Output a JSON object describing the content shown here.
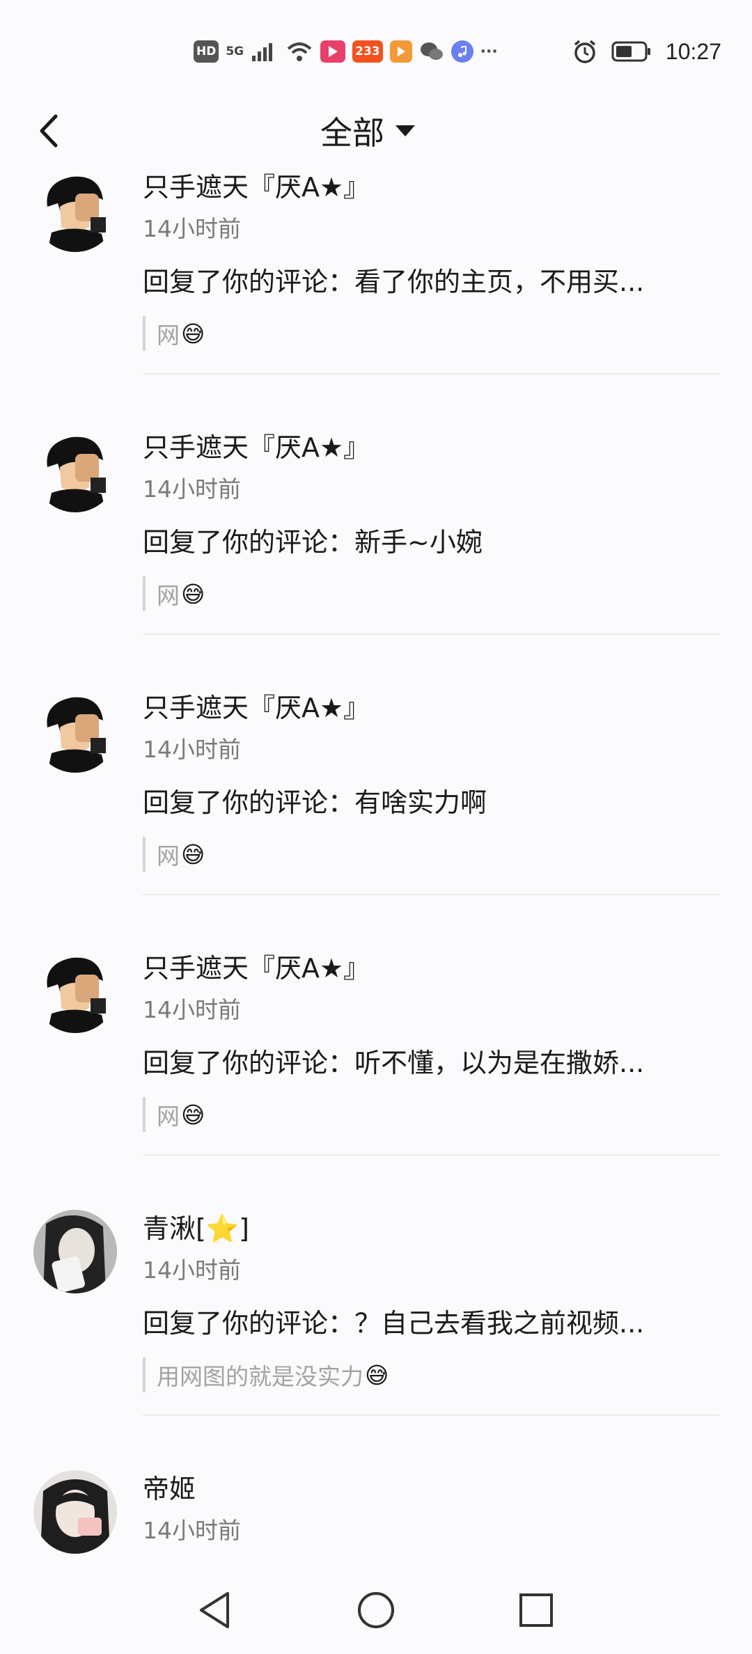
{
  "status_bar": {
    "hd_label": "HD",
    "network_label": "5G",
    "app_badge_233": "233",
    "more_label": "···",
    "time": "10:27"
  },
  "header": {
    "title": "全部"
  },
  "items": [
    {
      "user": "只手遮天『厌A★』",
      "time": "14小时前",
      "comment": "回复了你的评论：看了你的主页，不用买...",
      "quote": "网",
      "quote_emoji": "😅",
      "avatar": "anime-boy-avatar"
    },
    {
      "user": "只手遮天『厌A★』",
      "time": "14小时前",
      "comment": "回复了你的评论：新手~小婉",
      "quote": "网",
      "quote_emoji": "😅",
      "avatar": "anime-boy-avatar"
    },
    {
      "user": "只手遮天『厌A★』",
      "time": "14小时前",
      "comment": "回复了你的评论：有啥实力啊",
      "quote": "网",
      "quote_emoji": "😅",
      "avatar": "anime-boy-avatar"
    },
    {
      "user": "只手遮天『厌A★』",
      "time": "14小时前",
      "comment": "回复了你的评论：听不懂，以为是在撒娇...",
      "quote": "网",
      "quote_emoji": "😅",
      "avatar": "anime-boy-avatar"
    },
    {
      "user": "青湫[⭐]",
      "time": "14小时前",
      "comment": "回复了你的评论：？自己去看我之前视频...",
      "quote": "用网图的就是没实力",
      "quote_emoji": "😅",
      "avatar": "girl-photo-avatar"
    },
    {
      "user": "帝姬",
      "time": "14小时前",
      "comment": "",
      "quote": "",
      "quote_emoji": "",
      "avatar": "girl-photo-avatar-2"
    }
  ],
  "colors": {
    "background": "#fbfafc",
    "text_primary": "#1a1a1a",
    "text_secondary": "#7a7a7a",
    "quote_text": "#a3a3a3",
    "divider": "#ececec"
  },
  "icons": [
    "back-icon",
    "caret-down-icon",
    "wifi-icon",
    "signal-icon",
    "alarm-icon",
    "battery-icon",
    "nav-back-icon",
    "nav-home-icon",
    "nav-recents-icon"
  ]
}
